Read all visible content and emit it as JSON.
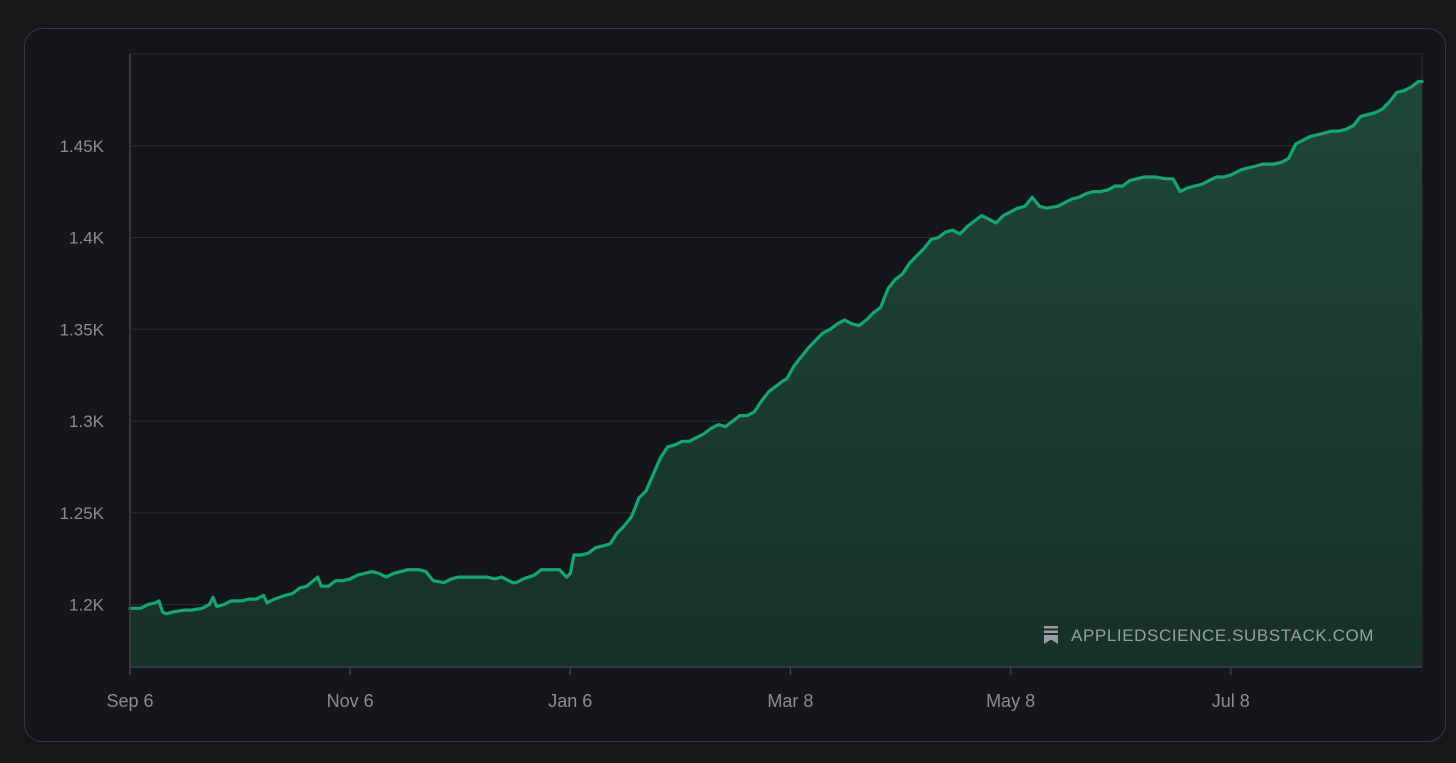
{
  "chart_data": {
    "type": "area",
    "title": "",
    "xlabel": "",
    "ylabel": "",
    "x_tick_labels": [
      "Sep 6",
      "Nov 6",
      "Jan 6",
      "Mar 8",
      "May 8",
      "Jul 8"
    ],
    "y_tick_labels": [
      "1.2K",
      "1.25K",
      "1.3K",
      "1.35K",
      "1.4K",
      "1.45K"
    ],
    "y_ticks": [
      1200,
      1250,
      1300,
      1350,
      1400,
      1450
    ],
    "ylim": [
      1166,
      1500
    ],
    "x_range_days": [
      0,
      358
    ],
    "x_tick_days": [
      0,
      61,
      122,
      183,
      244,
      305
    ],
    "grid": true,
    "colors": {
      "line": "#16a571",
      "fill": "#1a3a2e",
      "grid": "#2a2c30",
      "axis": "#3d4045"
    },
    "series": [
      {
        "values": [
          [
            0,
            1198
          ],
          [
            3,
            1198
          ],
          [
            5,
            1200
          ],
          [
            7,
            1201
          ],
          [
            8,
            1202
          ],
          [
            9,
            1196
          ],
          [
            10,
            1195
          ],
          [
            12,
            1196
          ],
          [
            15,
            1197
          ],
          [
            17,
            1197
          ],
          [
            20,
            1198
          ],
          [
            22,
            1200
          ],
          [
            23,
            1204
          ],
          [
            24,
            1199
          ],
          [
            26,
            1200
          ],
          [
            28,
            1202
          ],
          [
            31,
            1202
          ],
          [
            33,
            1203
          ],
          [
            35,
            1203
          ],
          [
            37,
            1205
          ],
          [
            38,
            1201
          ],
          [
            40,
            1203
          ],
          [
            43,
            1205
          ],
          [
            45,
            1206
          ],
          [
            47,
            1209
          ],
          [
            49,
            1210
          ],
          [
            52,
            1215
          ],
          [
            53,
            1210
          ],
          [
            55,
            1210
          ],
          [
            57,
            1213
          ],
          [
            59,
            1213
          ],
          [
            61,
            1214
          ],
          [
            63,
            1216
          ],
          [
            65,
            1217
          ],
          [
            67,
            1218
          ],
          [
            69,
            1217
          ],
          [
            71,
            1215
          ],
          [
            73,
            1217
          ],
          [
            75,
            1218
          ],
          [
            77,
            1219
          ],
          [
            80,
            1219
          ],
          [
            82,
            1218
          ],
          [
            84,
            1213
          ],
          [
            87,
            1212
          ],
          [
            89,
            1214
          ],
          [
            91,
            1215
          ],
          [
            93,
            1215
          ],
          [
            96,
            1215
          ],
          [
            99,
            1215
          ],
          [
            101,
            1214
          ],
          [
            103,
            1215
          ],
          [
            106,
            1212
          ],
          [
            107,
            1212
          ],
          [
            109,
            1214
          ],
          [
            112,
            1216
          ],
          [
            114,
            1219
          ],
          [
            117,
            1219
          ],
          [
            119,
            1219
          ],
          [
            121,
            1215
          ],
          [
            122,
            1217
          ],
          [
            123,
            1227
          ],
          [
            125,
            1227
          ],
          [
            127,
            1228
          ],
          [
            129,
            1231
          ],
          [
            131,
            1232
          ],
          [
            133,
            1233
          ],
          [
            135,
            1239
          ],
          [
            137,
            1243
          ],
          [
            139,
            1248
          ],
          [
            141,
            1258
          ],
          [
            143,
            1262
          ],
          [
            145,
            1271
          ],
          [
            147,
            1280
          ],
          [
            149,
            1286
          ],
          [
            151,
            1287
          ],
          [
            153,
            1289
          ],
          [
            155,
            1289
          ],
          [
            157,
            1291
          ],
          [
            159,
            1293
          ],
          [
            161,
            1296
          ],
          [
            163,
            1298
          ],
          [
            165,
            1297
          ],
          [
            167,
            1300
          ],
          [
            169,
            1303
          ],
          [
            171,
            1303
          ],
          [
            173,
            1305
          ],
          [
            175,
            1311
          ],
          [
            177,
            1316
          ],
          [
            179,
            1319
          ],
          [
            181,
            1322
          ],
          [
            182,
            1323
          ],
          [
            184,
            1330
          ],
          [
            186,
            1335
          ],
          [
            188,
            1340
          ],
          [
            190,
            1344
          ],
          [
            192,
            1348
          ],
          [
            194,
            1350
          ],
          [
            196,
            1353
          ],
          [
            198,
            1355
          ],
          [
            200,
            1353
          ],
          [
            202,
            1352
          ],
          [
            204,
            1355
          ],
          [
            206,
            1359
          ],
          [
            208,
            1362
          ],
          [
            210,
            1372
          ],
          [
            212,
            1377
          ],
          [
            214,
            1380
          ],
          [
            216,
            1386
          ],
          [
            218,
            1390
          ],
          [
            220,
            1394
          ],
          [
            222,
            1399
          ],
          [
            224,
            1400
          ],
          [
            226,
            1403
          ],
          [
            228,
            1404
          ],
          [
            230,
            1402
          ],
          [
            232,
            1406
          ],
          [
            234,
            1409
          ],
          [
            236,
            1412
          ],
          [
            238,
            1410
          ],
          [
            240,
            1408
          ],
          [
            242,
            1412
          ],
          [
            244,
            1414
          ],
          [
            246,
            1416
          ],
          [
            248,
            1417
          ],
          [
            250,
            1422
          ],
          [
            252,
            1417
          ],
          [
            254,
            1416
          ],
          [
            257,
            1417
          ],
          [
            259,
            1419
          ],
          [
            261,
            1421
          ],
          [
            263,
            1422
          ],
          [
            265,
            1424
          ],
          [
            267,
            1425
          ],
          [
            269,
            1425
          ],
          [
            271,
            1426
          ],
          [
            273,
            1428
          ],
          [
            275,
            1428
          ],
          [
            277,
            1431
          ],
          [
            279,
            1432
          ],
          [
            281,
            1433
          ],
          [
            284,
            1433
          ],
          [
            287,
            1432
          ],
          [
            289,
            1432
          ],
          [
            291,
            1425
          ],
          [
            293,
            1427
          ],
          [
            295,
            1428
          ],
          [
            297,
            1429
          ],
          [
            299,
            1431
          ],
          [
            301,
            1433
          ],
          [
            303,
            1433
          ],
          [
            305,
            1434
          ],
          [
            308,
            1437
          ],
          [
            310,
            1438
          ],
          [
            312,
            1439
          ],
          [
            314,
            1440
          ],
          [
            317,
            1440
          ],
          [
            319,
            1441
          ],
          [
            321,
            1443
          ],
          [
            323,
            1451
          ],
          [
            325,
            1453
          ],
          [
            327,
            1455
          ],
          [
            329,
            1456
          ],
          [
            331,
            1457
          ],
          [
            333,
            1458
          ],
          [
            335,
            1458
          ],
          [
            337,
            1459
          ],
          [
            339,
            1461
          ],
          [
            341,
            1466
          ],
          [
            343,
            1467
          ],
          [
            345,
            1468
          ],
          [
            347,
            1470
          ],
          [
            349,
            1474
          ],
          [
            351,
            1479
          ],
          [
            353,
            1480
          ],
          [
            355,
            1482
          ],
          [
            357,
            1485
          ],
          [
            358,
            1485
          ]
        ]
      }
    ],
    "watermark": "APPLIEDSCIENCE.SUBSTACK.COM"
  }
}
